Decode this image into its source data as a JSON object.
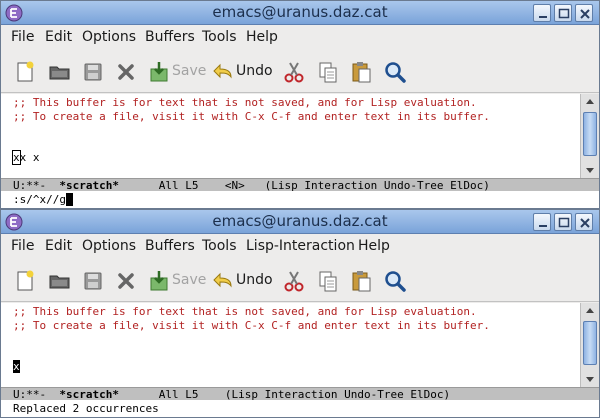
{
  "windows": [
    {
      "title": "emacs@uranus.daz.cat",
      "menu": [
        "File",
        "Edit",
        "Options",
        "Buffers",
        "Tools",
        "Help"
      ],
      "toolbar": {
        "save_label": "Save",
        "undo_label": "Undo"
      },
      "buffer": {
        "comment1": ";; This buffer is for text that is not saved, and for Lisp evaluation.",
        "comment2": ";; To create a file, visit it with C-x C-f and enter text in its buffer.",
        "text_cursor": "x",
        "text_rest": "x x"
      },
      "modeline": {
        "status": "U:**-  ",
        "buffer_name": "*scratch*",
        "position": "      All L5    <N>   (Lisp Interaction Undo-Tree ElDoc)"
      },
      "minibuffer": ":s/^x//g"
    },
    {
      "title": "emacs@uranus.daz.cat",
      "menu": [
        "File",
        "Edit",
        "Options",
        "Buffers",
        "Tools",
        "Lisp-Interaction",
        "Help"
      ],
      "toolbar": {
        "save_label": "Save",
        "undo_label": "Undo"
      },
      "buffer": {
        "comment1": ";; This buffer is for text that is not saved, and for Lisp evaluation.",
        "comment2": ";; To create a file, visit it with C-x C-f and enter text in its buffer.",
        "text_cursor": "x"
      },
      "modeline": {
        "status": "U:**-  ",
        "buffer_name": "*scratch*",
        "position": "      All L5    (Lisp Interaction Undo-Tree ElDoc)"
      },
      "minibuffer": "Replaced 2 occurrences"
    }
  ],
  "icons": {
    "app": "emacs-icon",
    "new": "new-file-icon",
    "open": "open-folder-icon",
    "save_disk": "save-disk-icon",
    "close": "close-x-icon",
    "save_as": "save-download-icon",
    "undo": "undo-arrow-icon",
    "cut": "scissors-icon",
    "copy": "copy-icon",
    "paste": "paste-icon",
    "search": "magnifier-icon"
  },
  "colors": {
    "comment": "#b22222",
    "titlebar": "#7aa3d9",
    "modeline": "#bfbfbf"
  }
}
